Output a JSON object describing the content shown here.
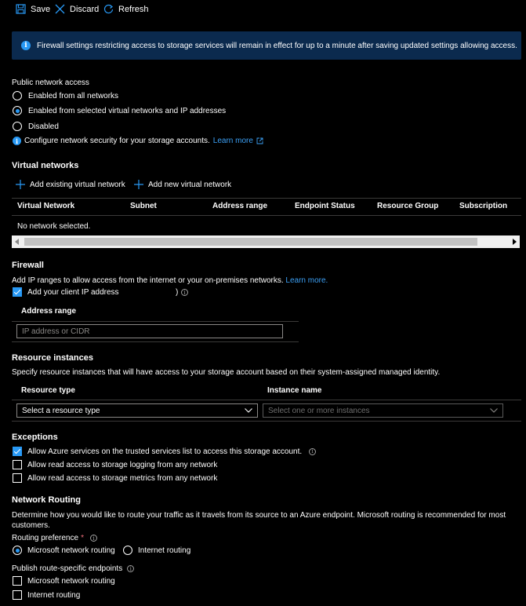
{
  "toolbar": {
    "save_label": "Save",
    "discard_label": "Discard",
    "refresh_label": "Refresh"
  },
  "banner": {
    "text": "Firewall settings restricting access to storage services will remain in effect for up to a minute after saving updated settings allowing access."
  },
  "public_access": {
    "label": "Public network access",
    "options": [
      "Enabled from all networks",
      "Enabled from selected virtual networks and IP addresses",
      "Disabled"
    ],
    "selected": "Enabled from selected virtual networks and IP addresses",
    "info_text": "Configure network security for your storage accounts.",
    "learn_more": "Learn more"
  },
  "virtual_networks": {
    "title": "Virtual networks",
    "add_existing": "Add existing virtual network",
    "add_new": "Add new virtual network",
    "columns": [
      "Virtual Network",
      "Subnet",
      "Address range",
      "Endpoint Status",
      "Resource Group",
      "Subscription"
    ],
    "empty_text": "No network selected."
  },
  "firewall": {
    "title": "Firewall",
    "description": "Add IP ranges to allow access from the internet or your on-premises networks.",
    "learn_more": "Learn more.",
    "client_ip_label": "Add your client IP address (",
    "client_ip_suffix": ")",
    "client_ip_checked": true,
    "address_range_header": "Address range",
    "ip_placeholder": "IP address or CIDR"
  },
  "resource_instances": {
    "title": "Resource instances",
    "description": "Specify resource instances that will have access to your storage account based on their system-assigned managed identity.",
    "resource_type_header": "Resource type",
    "instance_name_header": "Instance name",
    "resource_type_placeholder": "Select a resource type",
    "instance_placeholder": "Select one or more instances"
  },
  "exceptions": {
    "title": "Exceptions",
    "items": [
      {
        "label": "Allow Azure services on the trusted services list to access this storage account.",
        "checked": true
      },
      {
        "label": "Allow read access to storage logging from any network",
        "checked": false
      },
      {
        "label": "Allow read access to storage metrics from any network",
        "checked": false
      }
    ]
  },
  "network_routing": {
    "title": "Network Routing",
    "description": "Determine how you would like to route your traffic as it travels from its source to an Azure endpoint. Microsoft routing is recommended for most customers.",
    "routing_pref_label": "Routing preference",
    "required_mark": "*",
    "routing_options": [
      "Microsoft network routing",
      "Internet routing"
    ],
    "routing_selected": "Microsoft network routing",
    "publish_label": "Publish route-specific endpoints",
    "publish_items": [
      {
        "label": "Microsoft network routing",
        "checked": false
      },
      {
        "label": "Internet routing",
        "checked": false
      }
    ]
  },
  "colors": {
    "accent": "#2899f5",
    "banner_bg": "#0b2a4e",
    "link": "#3ca0f5",
    "required": "#f1707b"
  }
}
